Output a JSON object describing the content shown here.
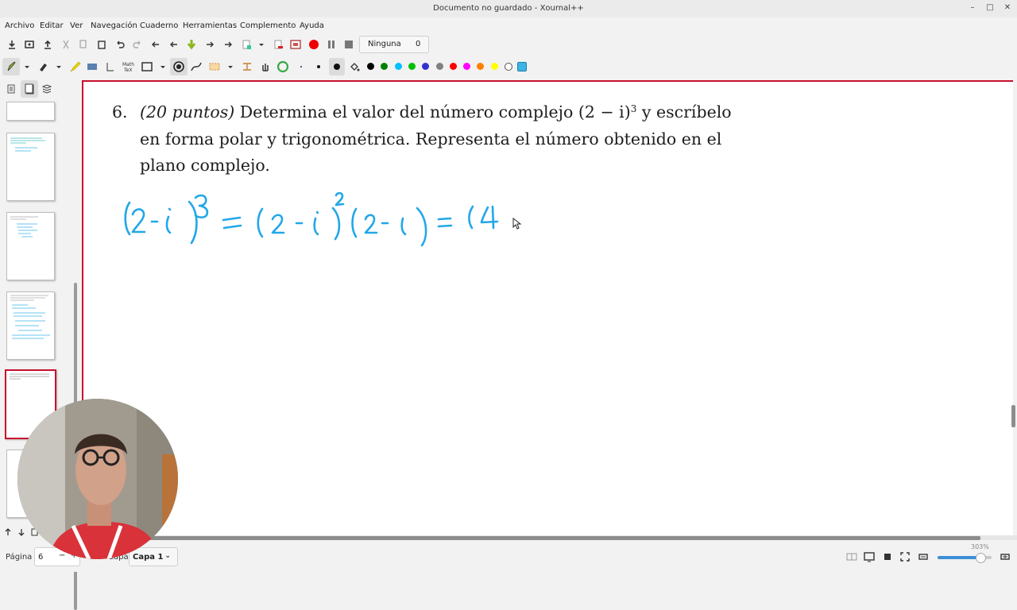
{
  "window": {
    "title": "Documento no guardado - Xournal++",
    "minimize_icon": "–",
    "maximize_icon": "□",
    "close_icon": "✕"
  },
  "menu": [
    "Archivo",
    "Editar",
    "Ver",
    "Navegación",
    "Cuaderno",
    "Herramientas",
    "Complemento",
    "Ayuda"
  ],
  "toolbar1": {
    "page_style": "Ninguna",
    "count": "0"
  },
  "toolbar2": {
    "colors": [
      "#000000",
      "#008000",
      "#00c0ff",
      "#00c000",
      "#3333cc",
      "#808080",
      "#ff0000",
      "#ff00ff",
      "#ff8000",
      "#ffff00",
      "#ffffff",
      "#3cb4e6"
    ],
    "selected_color": "#3cb4e6",
    "pen_color": "#22a7e8"
  },
  "document": {
    "problem_number": "6.",
    "line1_a": "(20 puntos)",
    "line1_b": " Determina el valor del número complejo (2 − i)",
    "exponent": "3",
    "line1_c": " y escríbelo",
    "line2": "en forma polar y trigonométrica. Representa el número obtenido en el",
    "line3": "plano complejo."
  },
  "handwriting": {
    "content": "(2-i)^3 = (2-i)^2 (2-i) = (4"
  },
  "statusbar": {
    "page_label": "Página",
    "page_value": "6",
    "layer_label": "Capa",
    "layer_value": "Capa 1",
    "zoom": "303%"
  },
  "accent": "#c8102e"
}
